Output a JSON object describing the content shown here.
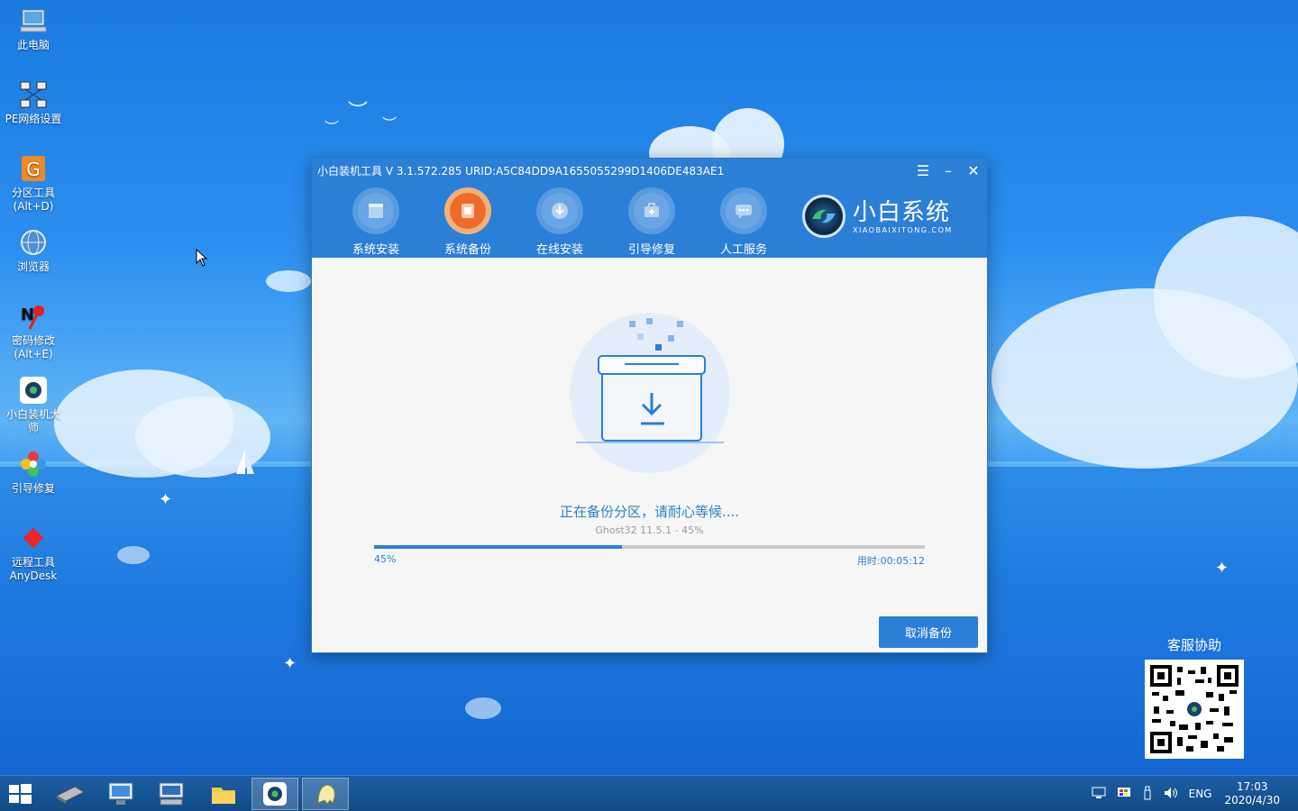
{
  "desktop": {
    "icons": [
      {
        "line1": "此电脑",
        "line2": ""
      },
      {
        "line1": "PE网络设置",
        "line2": ""
      },
      {
        "line1": "分区工具",
        "line2": "(Alt+D)"
      },
      {
        "line1": "浏览器",
        "line2": ""
      },
      {
        "line1": "密码修改",
        "line2": "(Alt+E)"
      },
      {
        "line1": "小白装机大",
        "line2": "师"
      },
      {
        "line1": "引导修复",
        "line2": ""
      },
      {
        "line1": "远程工具",
        "line2": "AnyDesk"
      }
    ]
  },
  "window": {
    "title": "小白装机工具 V 3.1.572.285 URID:A5C84DD9A1655055299D1406DE483AE1",
    "nav": [
      {
        "label": "系统安装",
        "icon": "system-install-icon"
      },
      {
        "label": "系统备份",
        "icon": "system-backup-icon"
      },
      {
        "label": "在线安装",
        "icon": "online-install-icon"
      },
      {
        "label": "引导修复",
        "icon": "boot-repair-icon"
      },
      {
        "label": "人工服务",
        "icon": "support-chat-icon"
      }
    ],
    "active_nav": "系统备份",
    "brand_name": "小白系统",
    "brand_url": "XIAOBAIXITONG.COM",
    "status": "正在备份分区，请耐心等候....",
    "substatus": "Ghost32 11.5.1 - 45%",
    "progress": 0.45,
    "progress_label": "45%",
    "elapsed": "用时:00:05:12",
    "cancel_label": "取消备份"
  },
  "qr": {
    "title": "客服协助"
  },
  "taskbar": {
    "lang": "ENG",
    "time": "17:03",
    "date": "2020/4/30"
  },
  "colors": {
    "accent": "#2c7fd7",
    "active_nav": "#ee6c2a"
  }
}
